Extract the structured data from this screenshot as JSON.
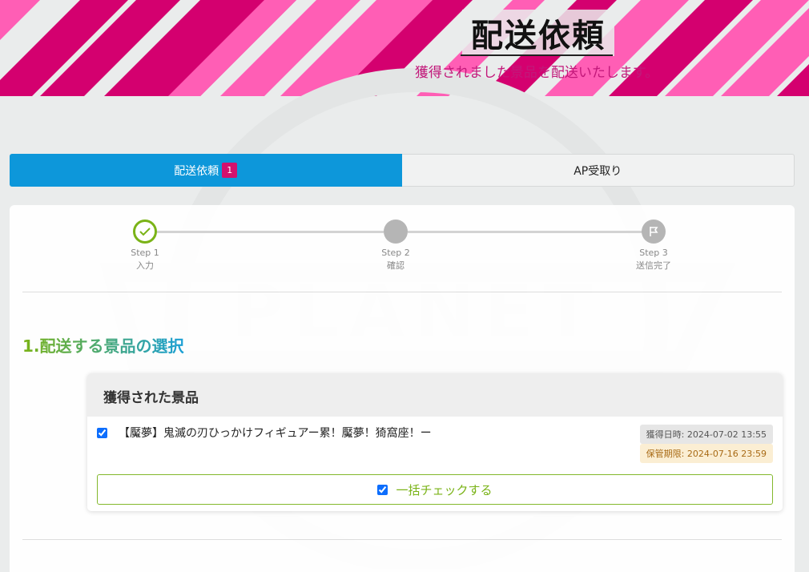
{
  "header": {
    "title": "配送依頼",
    "subtitle": "獲得されました景品を配送いたします。"
  },
  "tabs": [
    {
      "label": "配送依頼",
      "badge": "1",
      "active": true
    },
    {
      "label": "AP受取り",
      "active": false
    }
  ],
  "steps": [
    {
      "step": "Step 1",
      "label": "入力",
      "state": "done",
      "icon": "check-icon"
    },
    {
      "step": "Step 2",
      "label": "確認",
      "state": "pending",
      "icon": "none"
    },
    {
      "step": "Step 3",
      "label": "送信完了",
      "state": "pending",
      "icon": "flag-icon"
    }
  ],
  "section": {
    "title": "1.配送する景品の選択"
  },
  "prize_card": {
    "header": "獲得された景品",
    "items": [
      {
        "checked": true,
        "name": "【魘夢】鬼滅の刃ひっかけフィギュアー累！魘夢！猗窩座！ー",
        "acquired": "獲得日時: 2024-07-02 13:55",
        "expire": "保管期限: 2024-07-16 23:59"
      }
    ],
    "bulk_check_label": "一括チェックする"
  },
  "colors": {
    "tab_active": "#0d97da",
    "badge": "#d4116d",
    "step_done": "#7ab317",
    "subtitle": "#c2187a",
    "stripe_magenta": "#d4006f",
    "stripe_pink": "#ff5eb5"
  }
}
